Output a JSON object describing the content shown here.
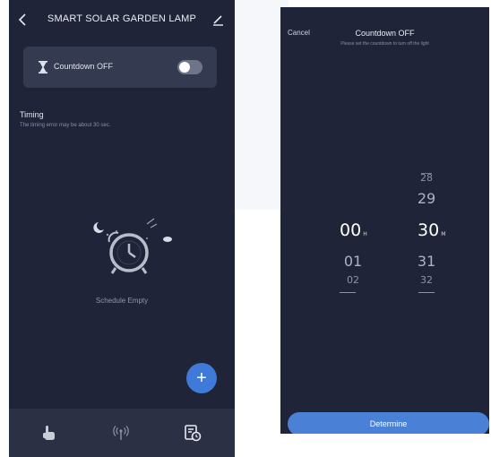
{
  "left": {
    "header": {
      "back_icon": "chevron-left-icon",
      "title": "SMART SOLAR GARDEN LAMP",
      "edit_icon": "edit-icon"
    },
    "countdown": {
      "icon": "hourglass-icon",
      "label": "Countdown OFF",
      "toggle_on": false
    },
    "timing": {
      "label": "Timing",
      "subtitle": "The timing error may be about 30 sec."
    },
    "empty": {
      "icon": "alarm-clock-icon",
      "text": "Schedule Empty"
    },
    "fab": {
      "icon": "plus-icon",
      "label": "+"
    },
    "nav": [
      {
        "icon": "hand-pointer-icon"
      },
      {
        "icon": "radio-signal-icon"
      },
      {
        "icon": "schedule-icon",
        "active": true
      }
    ]
  },
  "right": {
    "cancel": "Cancel",
    "title": "Countdown OFF",
    "subtitle": "Please set the countdown to turn off the light",
    "hours": {
      "selected": "00",
      "unit": "H",
      "below": [
        "01",
        "02"
      ]
    },
    "minutes": {
      "above": [
        "28",
        "29"
      ],
      "selected": "30",
      "unit": "M",
      "below": [
        "31",
        "32"
      ]
    },
    "determine": "Determine"
  },
  "colors": {
    "background": "#1f2438",
    "card": "#343a50",
    "accent": "#3f7ad8",
    "nav": "#2b3045"
  }
}
